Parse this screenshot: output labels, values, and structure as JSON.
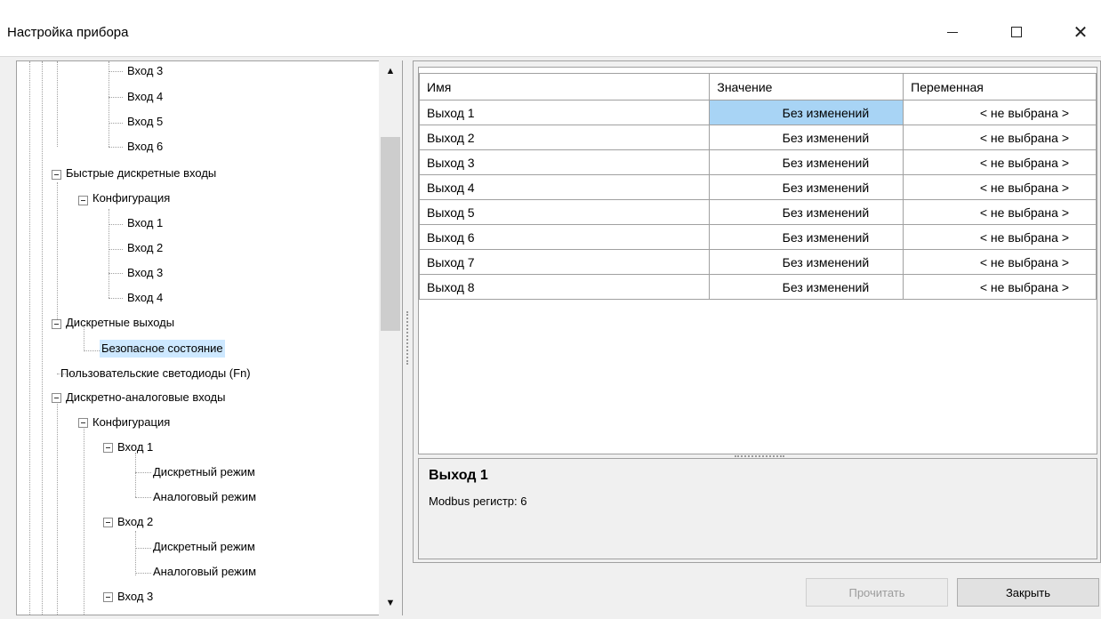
{
  "window": {
    "title": "Настройка прибора"
  },
  "tree": {
    "nodes": [
      {
        "label": "Вход 3"
      },
      {
        "label": "Вход 4"
      },
      {
        "label": "Вход 5"
      },
      {
        "label": "Вход 6"
      },
      {
        "label": "Быстрые дискретные входы"
      },
      {
        "label": "Конфигурация"
      },
      {
        "label": "Вход 1"
      },
      {
        "label": "Вход 2"
      },
      {
        "label": "Вход 3"
      },
      {
        "label": "Вход 4"
      },
      {
        "label": "Дискретные выходы"
      },
      {
        "label": "Безопасное состояние"
      },
      {
        "label": "Пользовательские светодиоды (Fn)"
      },
      {
        "label": "Дискретно-аналоговые входы"
      },
      {
        "label": "Конфигурация"
      },
      {
        "label": "Вход 1"
      },
      {
        "label": "Дискретный режим"
      },
      {
        "label": "Аналоговый режим"
      },
      {
        "label": "Вход 2"
      },
      {
        "label": "Дискретный режим"
      },
      {
        "label": "Аналоговый режим"
      },
      {
        "label": "Вход 3"
      }
    ],
    "scroll_up_icon": "▲",
    "scroll_down_icon": "▼"
  },
  "grid": {
    "headers": [
      "Имя",
      "Значение",
      "Переменная"
    ],
    "rows": [
      {
        "name": "Выход 1",
        "value": "Без изменений",
        "variable": "< не выбрана >"
      },
      {
        "name": "Выход 2",
        "value": "Без изменений",
        "variable": "< не выбрана >"
      },
      {
        "name": "Выход 3",
        "value": "Без изменений",
        "variable": "< не выбрана >"
      },
      {
        "name": "Выход 4",
        "value": "Без изменений",
        "variable": "< не выбрана >"
      },
      {
        "name": "Выход 5",
        "value": "Без изменений",
        "variable": "< не выбрана >"
      },
      {
        "name": "Выход 6",
        "value": "Без изменений",
        "variable": "< не выбрана >"
      },
      {
        "name": "Выход 7",
        "value": "Без изменений",
        "variable": "< не выбрана >"
      },
      {
        "name": "Выход 8",
        "value": "Без изменений",
        "variable": "< не выбрана >"
      }
    ]
  },
  "description": {
    "title": "Выход 1",
    "text": "Modbus регистр: 6"
  },
  "buttons": {
    "read": "Прочитать",
    "close": "Закрыть"
  },
  "colors": {
    "selected_cell": "#a8d4f5",
    "selected_tree_item": "#cde8ff"
  }
}
